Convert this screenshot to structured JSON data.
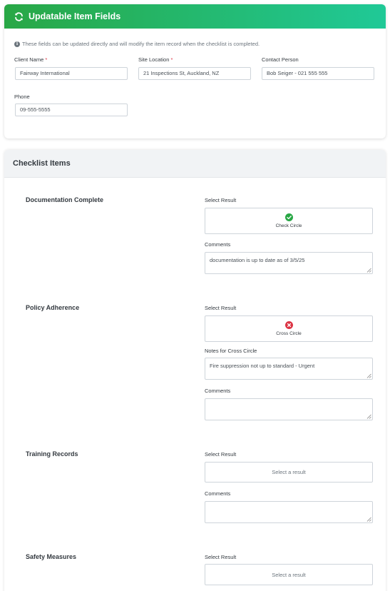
{
  "header": {
    "title": "Updatable Item Fields",
    "icon": "sync-icon",
    "gradient": [
      "#28a745",
      "#20c997"
    ]
  },
  "info": {
    "icon": "info-icon",
    "text": "These fields can be updated directly and will modify the item record when the checklist is completed."
  },
  "fields": {
    "client_name": {
      "label": "Client Name",
      "required": "*",
      "value": "Fairway International"
    },
    "site_location": {
      "label": "Site Location",
      "required": "*",
      "value": "21 Inspections St, Auckland, NZ"
    },
    "contact_person": {
      "label": "Contact Person",
      "value": "Bob Seiger - 021 555 555"
    },
    "phone": {
      "label": "Phone",
      "value": "09-555-5555"
    }
  },
  "checklist": {
    "title": "Checklist Items",
    "items": [
      {
        "title": "Documentation Complete",
        "select_label": "Select Result",
        "result": "Check Circle",
        "result_icon": "check-circle-icon",
        "result_color": "#28a745",
        "comments_label": "Comments",
        "comments": "documentation is up to date as of 3/5/25"
      },
      {
        "title": "Policy Adherence",
        "select_label": "Select Result",
        "result": "Cross Circle",
        "result_icon": "cross-circle-icon",
        "result_color": "#dc3545",
        "notes_label": "Notes for Cross Circle",
        "notes": "Fire suppression not up to standard - Urgent",
        "comments_label": "Comments",
        "comments": ""
      },
      {
        "title": "Training Records",
        "select_label": "Select Result",
        "placeholder": "Select a result",
        "comments_label": "Comments",
        "comments": ""
      },
      {
        "title": "Safety Measures",
        "select_label": "Select Result",
        "placeholder": "Select a result"
      }
    ]
  }
}
